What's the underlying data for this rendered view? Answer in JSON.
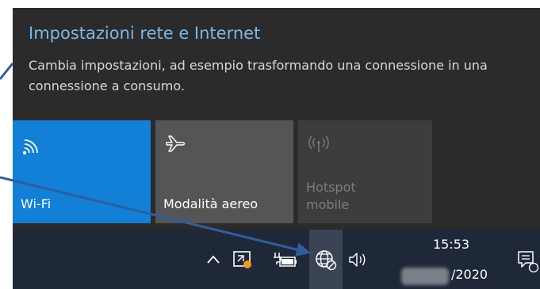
{
  "flyout": {
    "title": "Impostazioni rete e Internet",
    "description": "Cambia impostazioni, ad esempio trasformando una connessione in una connessione a consumo.",
    "tiles": [
      {
        "label": "Wi-Fi",
        "icon": "wifi-icon",
        "state": "on"
      },
      {
        "label": "Modalità aereo",
        "icon": "airplane-icon",
        "state": "off"
      },
      {
        "label": "Hotspot mobile",
        "icon": "hotspot-icon",
        "state": "disabled"
      }
    ]
  },
  "taskbar": {
    "icons": [
      "chevron-up-icon",
      "cast-icon",
      "battery-icon",
      "network-globe-icon",
      "volume-icon",
      "notification-icon"
    ],
    "time": "15:53",
    "date_suffix": "/2020"
  },
  "annotation": {
    "arrow_color": "#2e5e9e"
  },
  "colors": {
    "accent": "#1180d6",
    "title": "#7ab8e8",
    "flyout_bg": "#2b2b2b",
    "taskbar_bg": "#1e2838"
  }
}
